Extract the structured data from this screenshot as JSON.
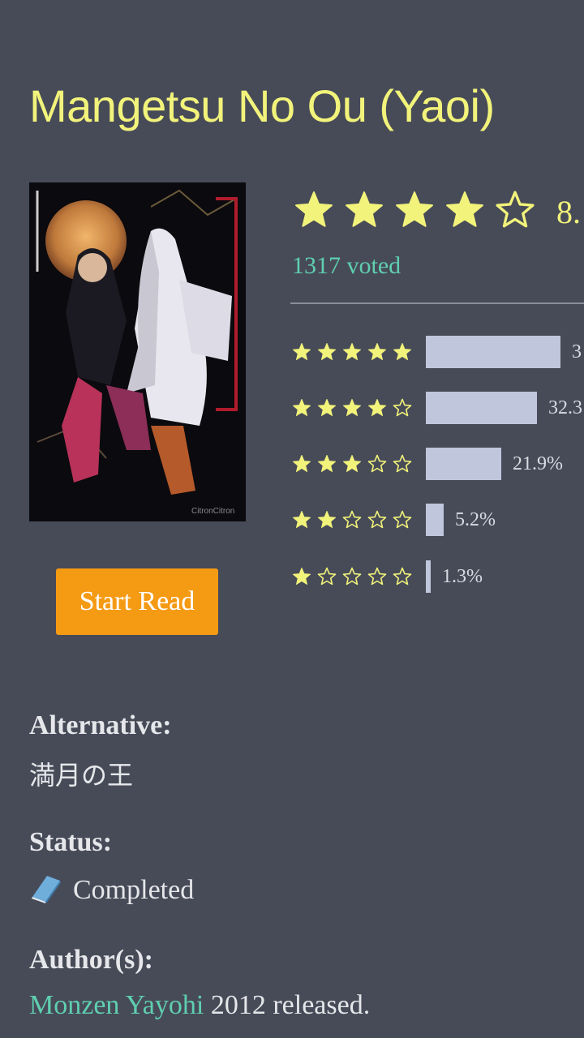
{
  "manga": {
    "title": "Mangetsu No Ou (Yaoi)",
    "start_read_label": "Start Read"
  },
  "rating": {
    "stars_filled": 4,
    "stars_total": 5,
    "score_text": "8.",
    "voted_text": "1317 voted",
    "distribution": [
      {
        "stars": 5,
        "percent_text": "3",
        "fraction": 0.39
      },
      {
        "stars": 4,
        "percent_text": "32.3",
        "fraction": 0.323
      },
      {
        "stars": 3,
        "percent_text": "21.9%",
        "fraction": 0.219
      },
      {
        "stars": 2,
        "percent_text": "5.2%",
        "fraction": 0.052
      },
      {
        "stars": 1,
        "percent_text": "1.3%",
        "fraction": 0.013
      }
    ]
  },
  "details": {
    "alternative_label": "Alternative:",
    "alternative_value": "満月の王",
    "status_label": "Status:",
    "status_value": "Completed",
    "status_icon": "book-icon",
    "authors_label": "Author(s):",
    "author_name": "Monzen Yayohi",
    "release_text": " 2012 released."
  },
  "colors": {
    "background": "#474b58",
    "title": "#f2f37a",
    "star": "#f2f37a",
    "accent_link": "#5fcfb0",
    "button": "#f59a13",
    "bar": "#c0c6db"
  }
}
